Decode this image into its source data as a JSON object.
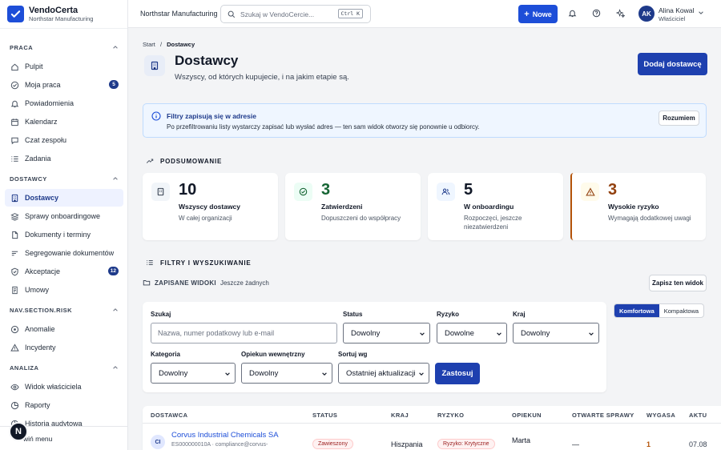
{
  "brand": {
    "name": "VendoCerta",
    "subtitle": "Northstar Manufacturing"
  },
  "sidebar": {
    "sections": [
      {
        "title": "PRACA",
        "items": [
          {
            "label": "Pulpit",
            "icon": "home-icon"
          },
          {
            "label": "Moja praca",
            "icon": "check-circle-icon",
            "badge": "5"
          },
          {
            "label": "Powiadomienia",
            "icon": "bell-icon"
          },
          {
            "label": "Kalendarz",
            "icon": "calendar-icon"
          },
          {
            "label": "Czat zespołu",
            "icon": "chat-icon"
          },
          {
            "label": "Zadania",
            "icon": "tasks-icon"
          }
        ]
      },
      {
        "title": "DOSTAWCY",
        "items": [
          {
            "label": "Dostawcy",
            "icon": "building-icon",
            "active": true
          },
          {
            "label": "Sprawy onboardingowe",
            "icon": "layers-icon"
          },
          {
            "label": "Dokumenty i terminy",
            "icon": "document-icon"
          },
          {
            "label": "Segregowanie dokumentów",
            "icon": "sort-icon"
          },
          {
            "label": "Akceptacje",
            "icon": "shield-check-icon",
            "badge": "12"
          },
          {
            "label": "Umowy",
            "icon": "contract-icon"
          }
        ]
      },
      {
        "title": "NAV.SECTION.RISK",
        "items": [
          {
            "label": "Anomalie",
            "icon": "radar-icon"
          },
          {
            "label": "Incydenty",
            "icon": "warning-icon"
          }
        ]
      },
      {
        "title": "ANALIZA",
        "items": [
          {
            "label": "Widok właściciela",
            "icon": "eye-icon"
          },
          {
            "label": "Raporty",
            "icon": "chart-icon"
          },
          {
            "label": "Historia audytowa",
            "icon": "history-icon"
          }
        ]
      }
    ],
    "footer": {
      "label": "wiń menu",
      "avatar": "N"
    }
  },
  "topbar": {
    "org": "Northstar Manufacturing",
    "search_placeholder": "Szukaj w VendoCercie...",
    "search_shortcut": "Ctrl K",
    "new_label": "Nowe",
    "user": {
      "initials": "AK",
      "name": "Alina Kowal",
      "role": "Właściciel"
    }
  },
  "page": {
    "breadcrumb_root": "Start",
    "breadcrumb_sep": "/",
    "breadcrumb_current": "Dostawcy",
    "title": "Dostawcy",
    "subtitle": "Wszyscy, od których kupujecie, i na jakim etapie są.",
    "primary_action": "Dodaj dostawcę"
  },
  "info": {
    "title": "Filtry zapisują się w adresie",
    "text": "Po przefiltrowaniu listy wystarczy zapisać lub wysłać adres — ten sam widok otworzy się ponownie u odbiorcy.",
    "dismiss": "Rozumiem"
  },
  "summary": {
    "title": "PODSUMOWANIE",
    "cards": [
      {
        "number": "10",
        "title": "Wszyscy dostawcy",
        "desc": "W całej organizacji",
        "icon": "building-icon",
        "color": "#111827",
        "bg": "#f1f5f9"
      },
      {
        "number": "3",
        "title": "Zatwierdzeni",
        "desc": "Dopuszczeni do współpracy",
        "icon": "check-circle-icon",
        "color": "#166534",
        "bg": "#ecfdf5"
      },
      {
        "number": "5",
        "title": "W onboardingu",
        "desc": "Rozpoczęci, jeszcze niezatwierdzeni",
        "icon": "users-icon",
        "color": "#111827",
        "bg": "#eff6ff"
      },
      {
        "number": "3",
        "title": "Wysokie ryzyko",
        "desc": "Wymagają dodatkowej uwagi",
        "icon": "warning-icon",
        "color": "#92400e",
        "bg": "#fffbeb",
        "accent": "#b45309"
      }
    ]
  },
  "filters": {
    "title": "FILTRY I WYSZUKIWANIE",
    "saved_label": "ZAPISANE WIDOKI",
    "saved_empty": "Jeszcze żadnych",
    "save_view": "Zapisz ten widok",
    "search_label": "Szukaj",
    "search_placeholder": "Nazwa, numer podatkowy lub e-mail",
    "status_label": "Status",
    "status_value": "Dowolny",
    "risk_label": "Ryzyko",
    "risk_value": "Dowolne",
    "country_label": "Kraj",
    "country_value": "Dowolny",
    "category_label": "Kategoria",
    "category_value": "Dowolny",
    "owner_label": "Opiekun wewnętrzny",
    "owner_value": "Dowolny",
    "sort_label": "Sortuj wg",
    "sort_value": "Ostatniej aktualizacji",
    "apply": "Zastosuj",
    "density_comfort": "Komfortowa",
    "density_compact": "Kompaktowa"
  },
  "table": {
    "headers": [
      "DOSTAWCA",
      "STATUS",
      "KRAJ",
      "RYZYKO",
      "OPIEKUN",
      "OTWARTE SPRAWY",
      "WYGASA",
      "AKTU"
    ],
    "rows": [
      {
        "initials": "CI",
        "name": "Corvus Industrial Chemicals SA",
        "meta": "ES000000010A · compliance@corvus-",
        "status": "Zawieszony",
        "country": "Hiszpania",
        "risk": "Ryzyko: Krytyczne",
        "owner": "Marta",
        "open": "—",
        "expires": "1",
        "updated": "07.08"
      }
    ]
  }
}
